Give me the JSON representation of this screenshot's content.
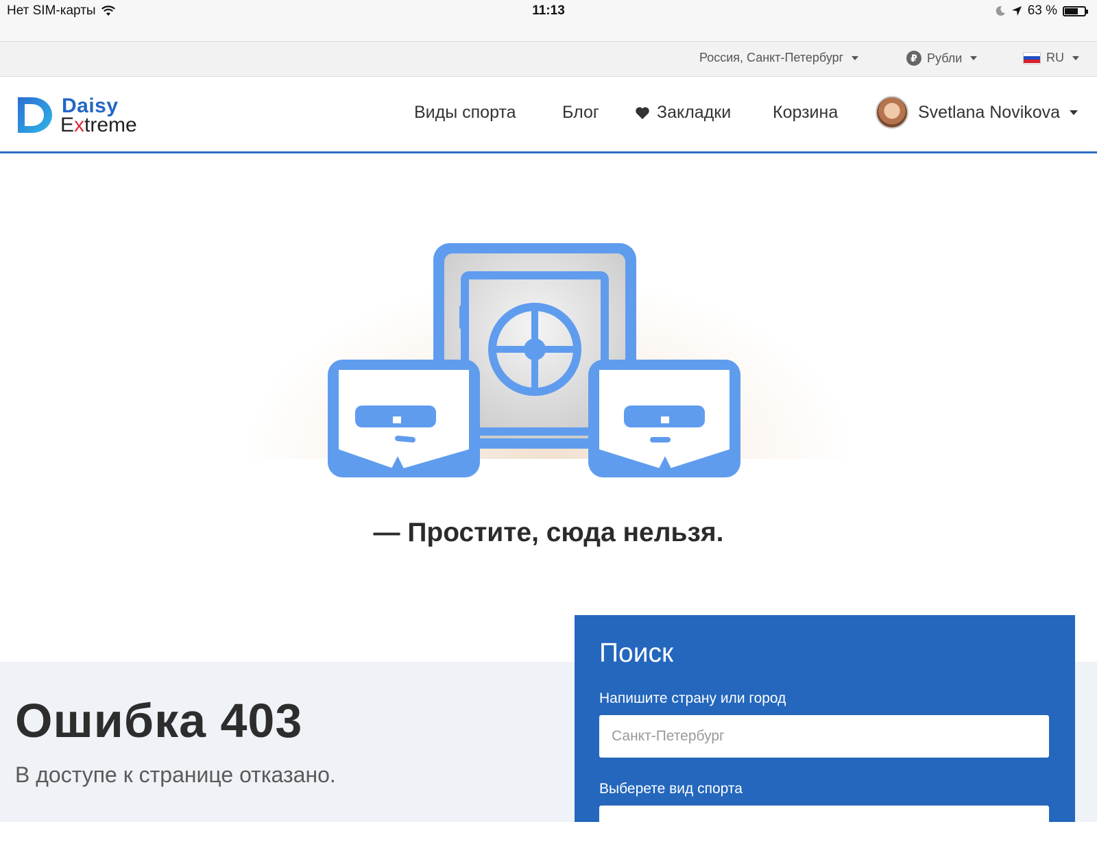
{
  "status_bar": {
    "carrier": "Нет SIM-карты",
    "time": "11:13",
    "battery": "63 %",
    "battery_level": 0.63
  },
  "util_bar": {
    "location": "Россия, Санкт-Петербург",
    "currency": "Рубли",
    "currency_symbol": "₽",
    "language": "RU"
  },
  "header": {
    "logo_line1": "Daisy",
    "logo_line2_a": "E",
    "logo_line2_x": "x",
    "logo_line2_b": "treme",
    "nav": {
      "sports": "Виды спорта",
      "blog": "Блог",
      "bookmarks": "Закладки",
      "cart": "Корзина"
    },
    "user_name": "Svetlana Novikova"
  },
  "hero": {
    "caption": "— Простите, сюда нельзя."
  },
  "error": {
    "title": "Ошибка 403",
    "subtitle": "В доступе к странице отказано."
  },
  "search": {
    "title": "Поиск",
    "location_label": "Напишите страну или город",
    "location_placeholder": "Санкт-Петербург",
    "sport_label": "Выберете вид спорта"
  },
  "colors": {
    "brand_blue": "#2467bd",
    "illustration_blue": "#5f9cee",
    "logo_red": "#e0283a"
  }
}
